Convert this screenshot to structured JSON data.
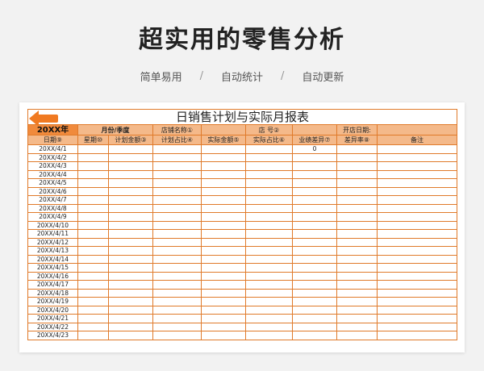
{
  "header": {
    "title": "超实用的零售分析",
    "tags": [
      "简单易用",
      "自动统计",
      "自动更新"
    ],
    "separator": "/"
  },
  "sheet": {
    "title": "日销售计划与实际月报表",
    "meta": {
      "year": "20XX年",
      "month_quarter": "月份/季度",
      "store_name": "店铺名称①",
      "store_no": "店 号②",
      "open_date": "开店日期:"
    },
    "columns": [
      "日期⑨",
      "星期⑩",
      "计划金额③",
      "计划占比④",
      "实际金额⑤",
      "实际占比⑥",
      "业绩差异⑦",
      "差异率⑧",
      "备注"
    ],
    "first_row_diff": "0",
    "dates": [
      "20XX/4/1",
      "20XX/4/2",
      "20XX/4/3",
      "20XX/4/4",
      "20XX/4/5",
      "20XX/4/6",
      "20XX/4/7",
      "20XX/4/8",
      "20XX/4/9",
      "20XX/4/10",
      "20XX/4/11",
      "20XX/4/12",
      "20XX/4/13",
      "20XX/4/14",
      "20XX/4/15",
      "20XX/4/16",
      "20XX/4/17",
      "20XX/4/18",
      "20XX/4/19",
      "20XX/4/20",
      "20XX/4/21",
      "20XX/4/22",
      "20XX/4/23"
    ]
  },
  "colors": {
    "accent": "#e07a2a",
    "header_fill": "#f4b98a",
    "year_fill": "#f08a3c"
  },
  "icons": {
    "back": "arrow-left-icon"
  }
}
